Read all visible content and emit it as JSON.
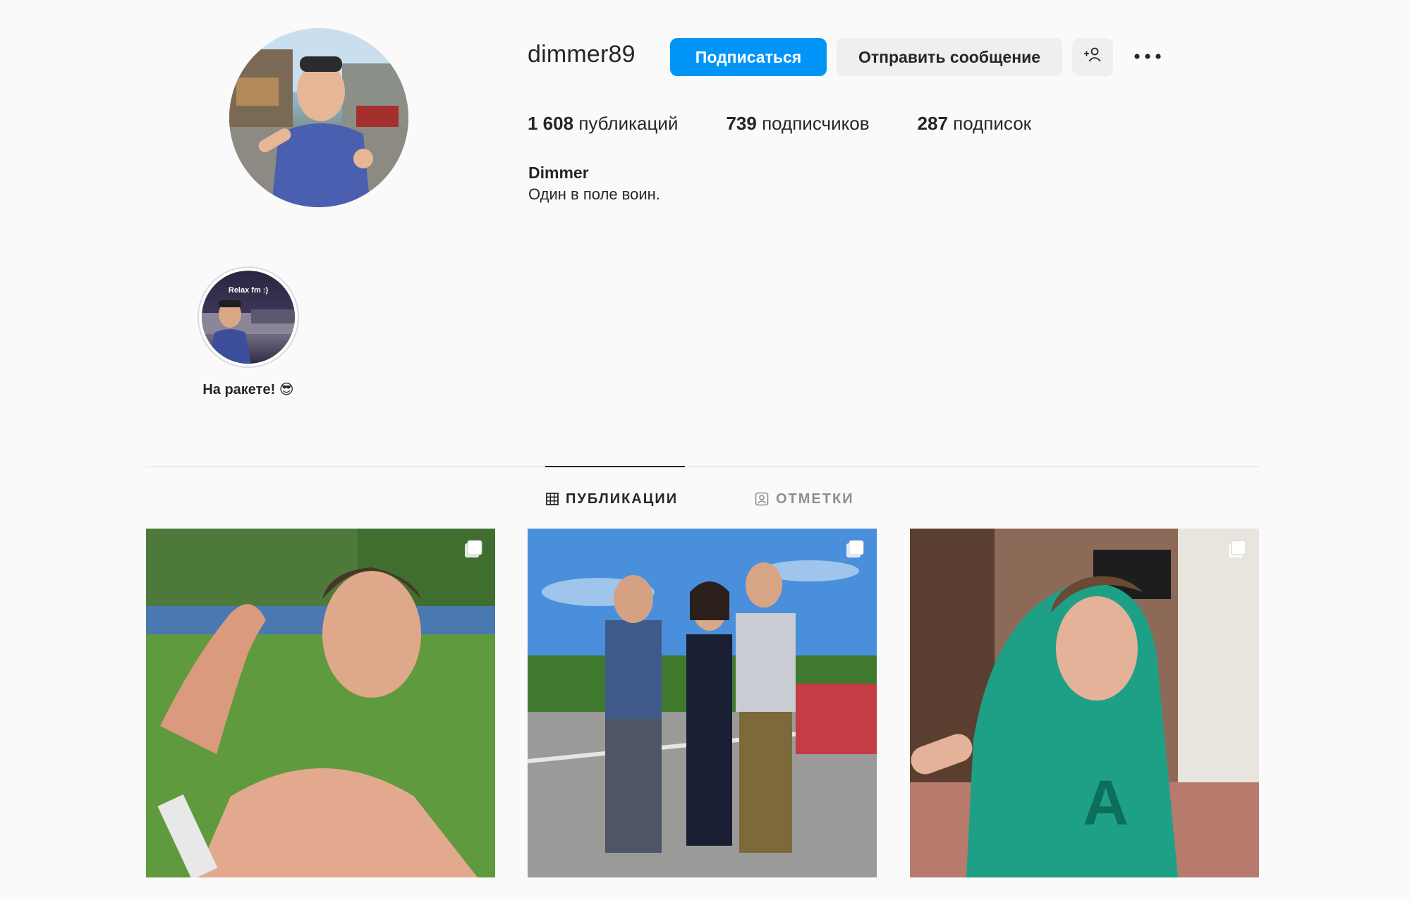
{
  "profile": {
    "username": "dimmer89",
    "full_name": "Dimmer",
    "bio": "Один в поле воин."
  },
  "actions": {
    "follow_label": "Подписаться",
    "message_label": "Отправить сообщение",
    "suggest_icon": "person-plus-icon",
    "more_icon": "more-horizontal-icon"
  },
  "stats": [
    {
      "count": "1 608",
      "label": "публикаций"
    },
    {
      "count": "739",
      "label": "подписчиков"
    },
    {
      "count": "287",
      "label": "подписок"
    }
  ],
  "highlights": [
    {
      "label": "На ракете! 😎",
      "image_text": "Relax fm :)"
    }
  ],
  "tabs": [
    {
      "label": "ПУБЛИКАЦИИ",
      "icon": "grid-icon",
      "active": true
    },
    {
      "label": "ОТМЕТКИ",
      "icon": "tagged-icon",
      "active": false
    }
  ],
  "posts": [
    {
      "type": "carousel",
      "icon": "carousel-icon"
    },
    {
      "type": "carousel",
      "icon": "carousel-icon"
    },
    {
      "type": "carousel",
      "icon": "carousel-icon"
    }
  ],
  "colors": {
    "accent": "#0095f6",
    "background": "#fafafa",
    "button_secondary": "#efefef",
    "text": "#262626",
    "muted": "#8e8e8e"
  }
}
